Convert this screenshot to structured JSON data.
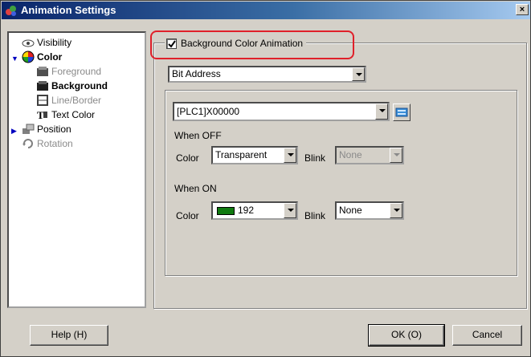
{
  "window": {
    "title": "Animation Settings",
    "close_glyph": "×"
  },
  "tree": {
    "items": [
      {
        "label": "Visibility",
        "icon": "visibility-icon",
        "state": "normal"
      },
      {
        "label": "Color",
        "icon": "color-wheel-icon",
        "state": "bold-expanded"
      },
      {
        "label": "Foreground",
        "icon": "foreground-icon",
        "state": "disabled"
      },
      {
        "label": "Background",
        "icon": "background-icon",
        "state": "selected-bold"
      },
      {
        "label": "Line/Border",
        "icon": "line-border-icon",
        "state": "disabled"
      },
      {
        "label": "Text Color",
        "icon": "text-color-icon",
        "state": "normal"
      },
      {
        "label": "Position",
        "icon": "position-icon",
        "state": "collapsed"
      },
      {
        "label": "Rotation",
        "icon": "rotation-icon",
        "state": "disabled"
      }
    ]
  },
  "main": {
    "checkbox_label": "Background Color Animation",
    "checkbox_checked": true,
    "mode_select": "Bit Address",
    "address_select": "[PLC1]X00000",
    "when_off": {
      "heading": "When OFF",
      "color_label": "Color",
      "color_value": "Transparent",
      "blink_label": "Blink",
      "blink_value": "None"
    },
    "when_on": {
      "heading": "When ON",
      "color_label": "Color",
      "color_value": "192",
      "color_swatch": "#107a10",
      "blink_label": "Blink",
      "blink_value": "None"
    }
  },
  "footer": {
    "help_label": "Help (H)",
    "ok_label": "OK (O)",
    "cancel_label": "Cancel"
  },
  "colors": {
    "highlight": "#e0202a",
    "title_start": "#0a246a",
    "title_end": "#a6caf0"
  }
}
